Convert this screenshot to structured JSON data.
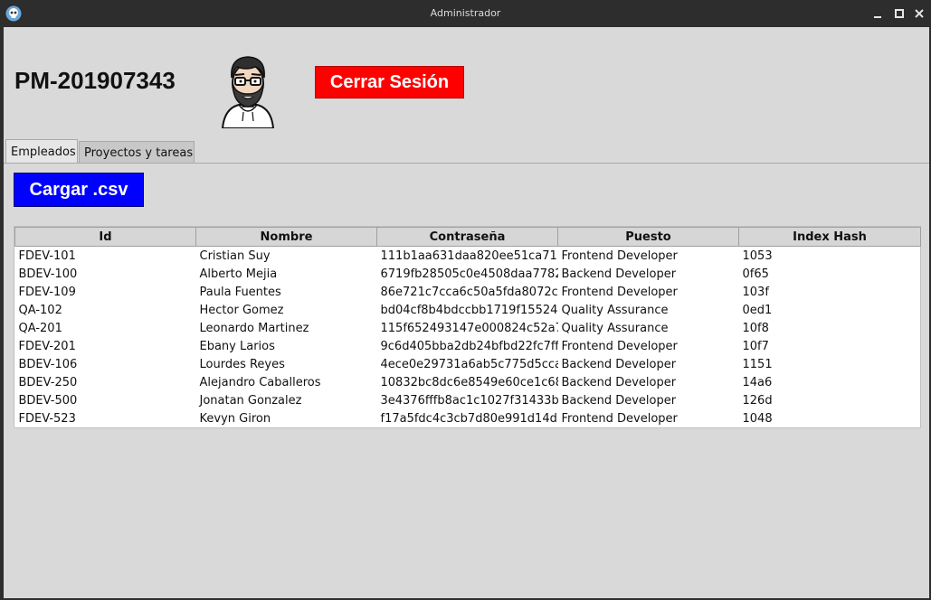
{
  "window": {
    "title": "Administrador"
  },
  "header": {
    "user_id": "PM-201907343",
    "logout_label": "Cerrar Sesión"
  },
  "tabs": [
    {
      "label": "Empleados",
      "active": true
    },
    {
      "label": "Proyectos y tareas",
      "active": false
    }
  ],
  "toolbar": {
    "load_csv_label": "Cargar .csv"
  },
  "colors": {
    "logout_bg": "#ff0000",
    "load_bg": "#0000ff"
  },
  "icons": {
    "app": "skull-icon",
    "avatar": "bearded-man-avatar"
  },
  "table": {
    "columns": [
      "Id",
      "Nombre",
      "Contraseña",
      "Puesto",
      "Index Hash"
    ],
    "rows": [
      [
        "FDEV-101",
        "Cristian Suy",
        "111b1aa631daa820ee51ca71",
        "Frontend Developer",
        "1053"
      ],
      [
        "BDEV-100",
        "Alberto Mejia",
        "6719fb28505c0e4508daa7782",
        "Backend Developer",
        "0f65"
      ],
      [
        "FDEV-109",
        "Paula Fuentes",
        "86e721c7cca6c50a5fda8072c",
        "Frontend Developer",
        "103f"
      ],
      [
        "QA-102",
        "Hector Gomez",
        "bd04cf8b4bdccbb1719f15524",
        "Quality Assurance",
        "0ed1"
      ],
      [
        "QA-201",
        "Leonardo Martinez",
        "115f652493147e000824c52a7",
        "Quality Assurance",
        "10f8"
      ],
      [
        "FDEV-201",
        "Ebany Larios",
        "9c6d405bba2db24bfbd22fc7ff",
        "Frontend Developer",
        "10f7"
      ],
      [
        "BDEV-106",
        "Lourdes Reyes",
        "4ece0e29731a6ab5c775d5cca",
        "Backend Developer",
        "1151"
      ],
      [
        "BDEV-250",
        "Alejandro Caballeros",
        "10832bc8dc6e8549e60ce1c68",
        "Backend Developer",
        "14a6"
      ],
      [
        "BDEV-500",
        "Jonatan Gonzalez",
        "3e4376fffb8ac1c1027f31433b",
        "Backend Developer",
        "126d"
      ],
      [
        "FDEV-523",
        "Kevyn Giron",
        "f17a5fdc4c3cb7d80e991d14d",
        "Frontend Developer",
        "1048"
      ]
    ]
  }
}
